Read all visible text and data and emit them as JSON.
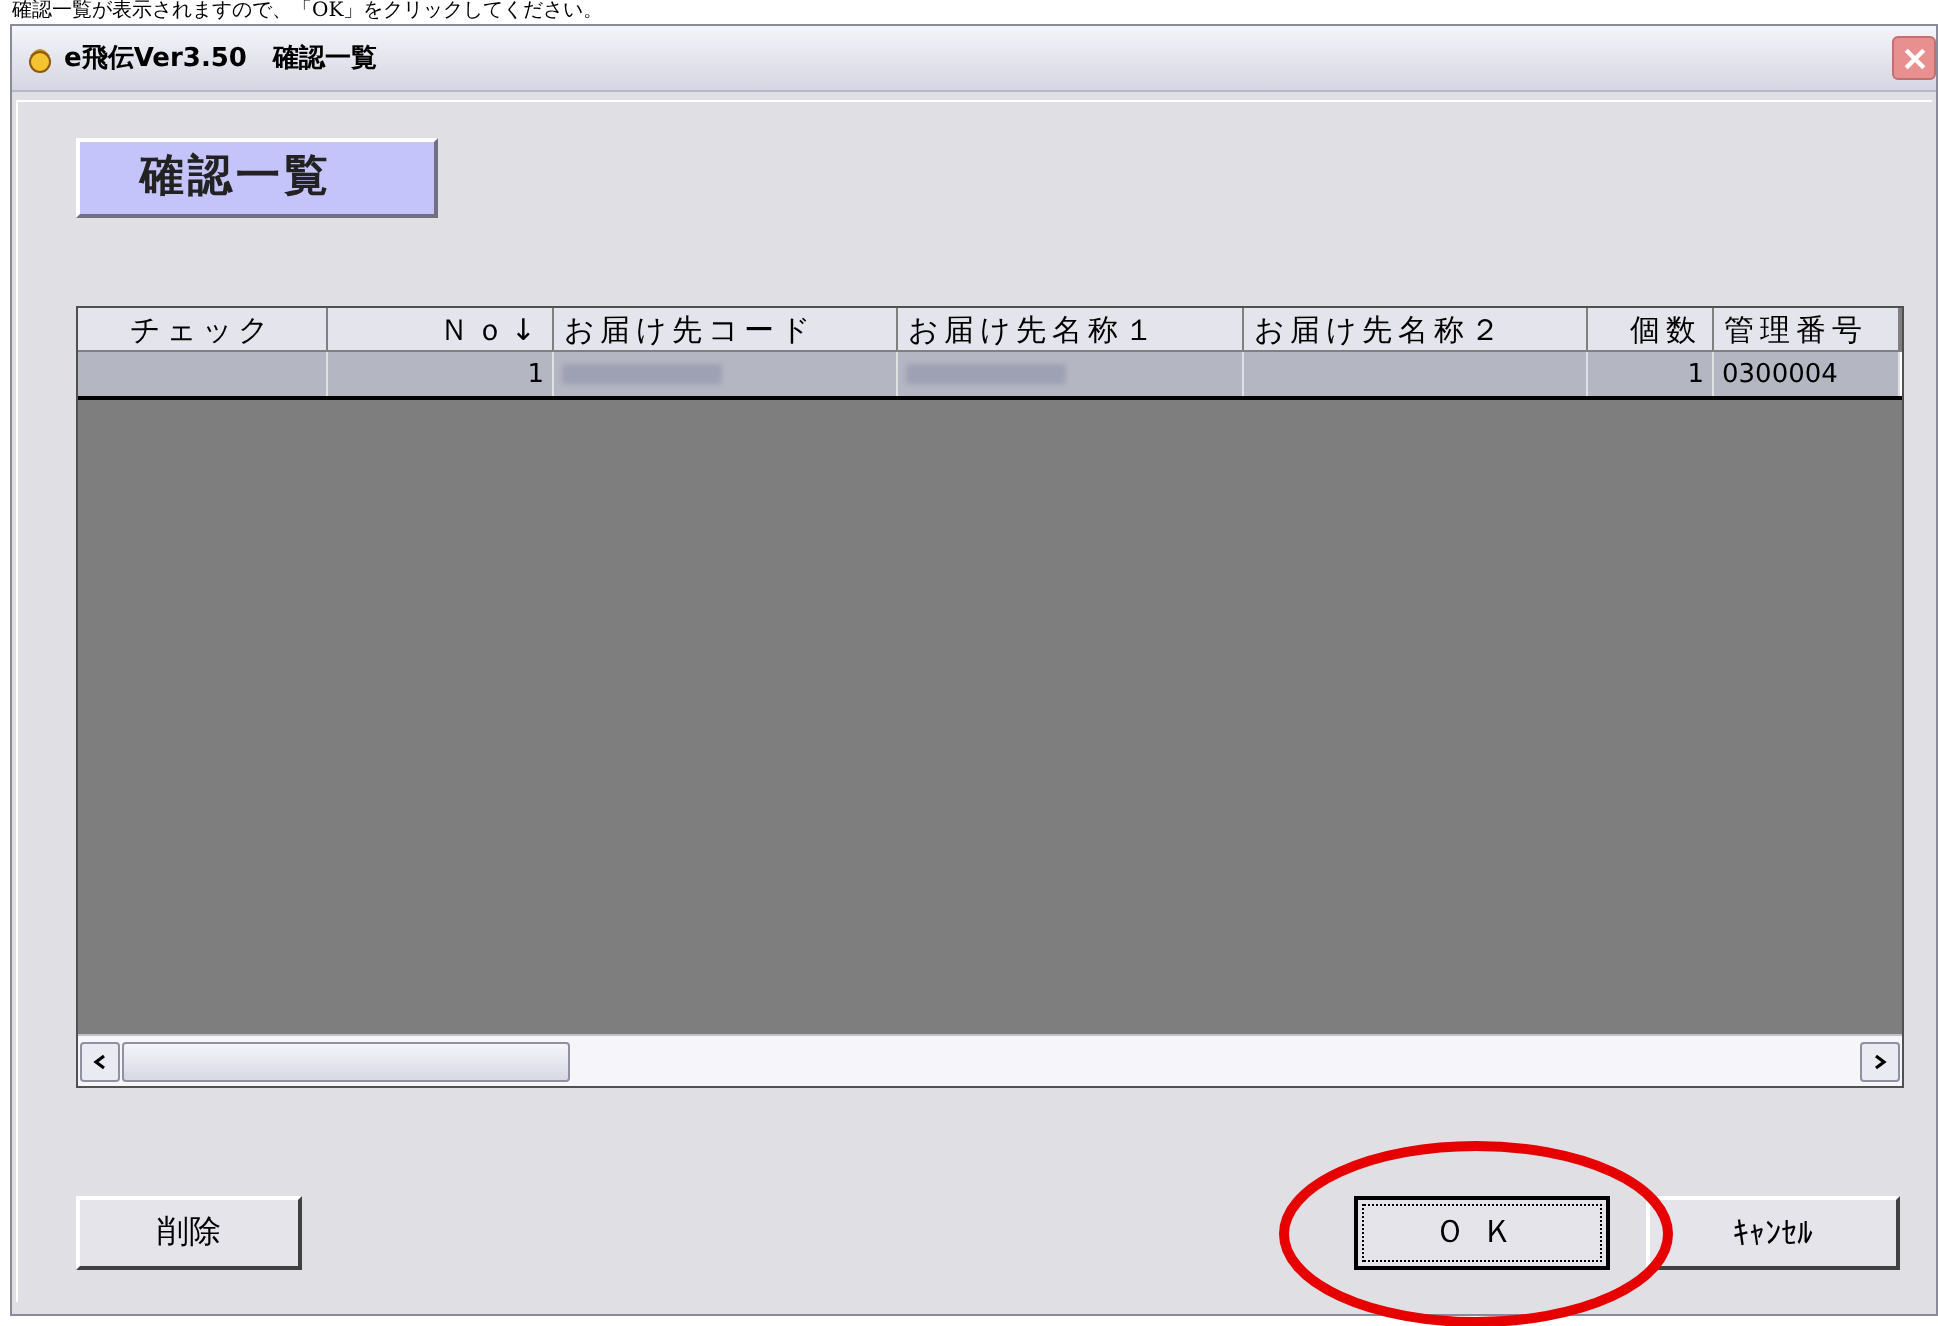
{
  "caption": "確認一覧が表示されますので、「OK」をクリックしてください。",
  "window": {
    "title": "e飛伝Ver3.50　確認一覧"
  },
  "heading": "確認一覧",
  "table": {
    "columns": [
      "チェック",
      "Ｎｏ↓",
      "お届け先コード",
      "お届け先名称１",
      "お届け先名称２",
      "個数",
      "管理番号"
    ],
    "rows": [
      {
        "selected": true,
        "cells": [
          {
            "kind": "empty"
          },
          {
            "kind": "text",
            "text": "1"
          },
          {
            "kind": "redacted"
          },
          {
            "kind": "redacted"
          },
          {
            "kind": "empty"
          },
          {
            "kind": "text",
            "text": "1"
          },
          {
            "kind": "text",
            "text": "0300004"
          }
        ]
      }
    ]
  },
  "buttons": [
    {
      "label": "削除",
      "focused": false
    },
    {
      "label": "ＯＫ",
      "focused": true
    },
    {
      "label": "ｷｬﾝｾﾙ",
      "focused": false
    }
  ]
}
